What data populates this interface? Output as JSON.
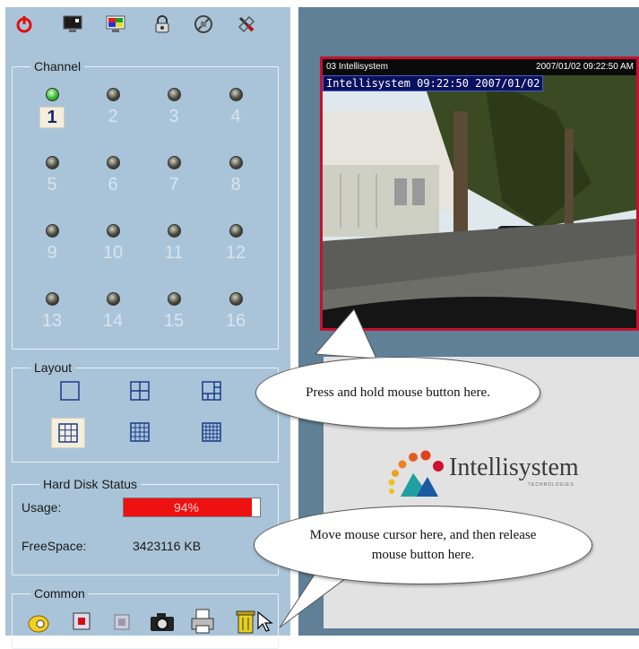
{
  "toolbar": {
    "icons": [
      "power-icon",
      "monitor-icon",
      "color-monitor-icon",
      "lock-icon",
      "no-record-icon",
      "tools-icon"
    ]
  },
  "channel": {
    "title": "Channel",
    "items": [
      {
        "num": "1",
        "active": true,
        "selected": true
      },
      {
        "num": "2"
      },
      {
        "num": "3"
      },
      {
        "num": "4"
      },
      {
        "num": "5"
      },
      {
        "num": "6"
      },
      {
        "num": "7"
      },
      {
        "num": "8"
      },
      {
        "num": "9"
      },
      {
        "num": "10"
      },
      {
        "num": "11"
      },
      {
        "num": "12"
      },
      {
        "num": "13"
      },
      {
        "num": "14"
      },
      {
        "num": "15"
      },
      {
        "num": "16"
      }
    ]
  },
  "layout": {
    "title": "Layout",
    "options": [
      "single",
      "quad",
      "one-plus-five",
      "three-by-three",
      "four-by-four",
      "five-by-five"
    ],
    "selected_index": 3
  },
  "hard_disk": {
    "title": "Hard Disk Status",
    "usage_label": "Usage:",
    "usage_value": "94%",
    "usage_fraction": 0.94,
    "free_label": "FreeSpace:",
    "free_value": "3423116 KB"
  },
  "common": {
    "title": "Common",
    "icons": [
      "speaker-icon",
      "record-icon",
      "stop-icon",
      "camera-icon",
      "printer-icon",
      "trash-icon"
    ]
  },
  "video": {
    "header_left": "03  Intellisystem",
    "header_right": "2007/01/02 09:22:50 AM",
    "osd": "Intellisystem 09:22:50 2007/01/02"
  },
  "logo": {
    "name": "Intellisystem",
    "sub": "TECHNOLOGIES"
  },
  "callouts": {
    "press": "Press and hold mouse button here.",
    "release": "Move mouse cursor here, and then release mouse button here."
  },
  "colors": {
    "selected_border": "#c8102e",
    "usage_bar": "#ee1111",
    "panel": "#a9c4d8"
  }
}
